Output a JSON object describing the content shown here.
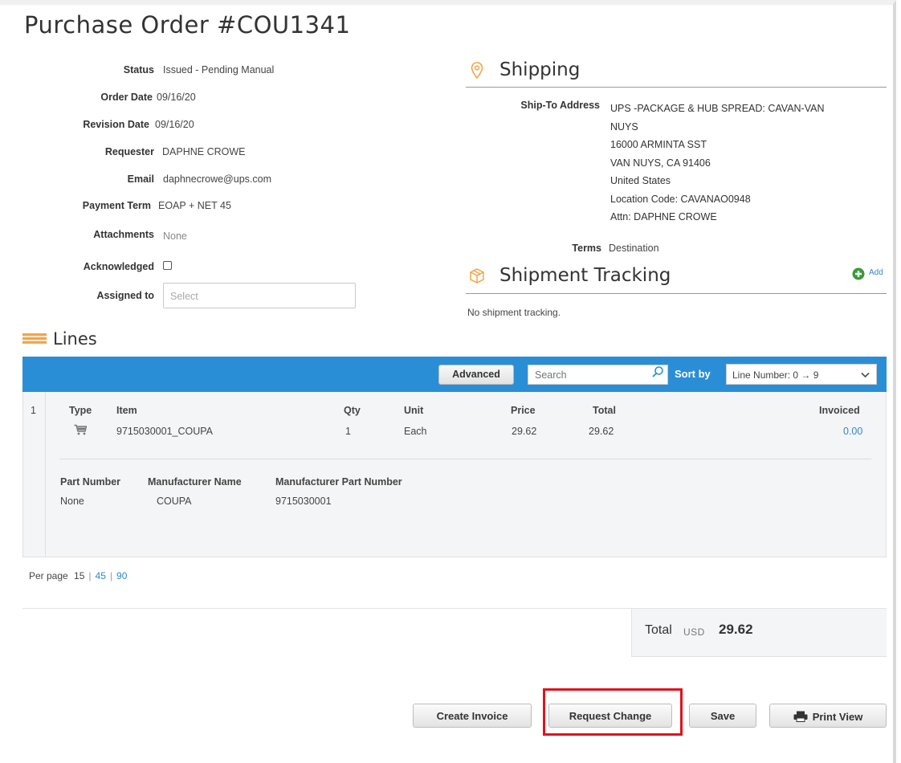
{
  "page": {
    "title": "Purchase Order #COU1341"
  },
  "details": {
    "status": {
      "label": "Status",
      "value": "Issued - Pending Manual"
    },
    "order_date": {
      "label": "Order Date",
      "value": "09/16/20"
    },
    "revision_date": {
      "label": "Revision Date",
      "value": "09/16/20"
    },
    "requester": {
      "label": "Requester",
      "value": "DAPHNE CROWE"
    },
    "email": {
      "label": "Email",
      "value": "daphnecrowe@ups.com"
    },
    "payment_term": {
      "label": "Payment Term",
      "value": "EOAP + NET 45"
    },
    "attachments": {
      "label": "Attachments",
      "value": "None"
    },
    "acknowledged": {
      "label": "Acknowledged",
      "checked": false
    },
    "assigned_to": {
      "label": "Assigned to",
      "placeholder": "Select"
    }
  },
  "shipping": {
    "heading": "Shipping",
    "icon": "location-pin-icon",
    "ship_to_label": "Ship-To Address",
    "address_lines": [
      "UPS -PACKAGE & HUB SPREAD: CAVAN-VAN",
      "NUYS",
      "16000 ARMINTA SST",
      "VAN NUYS, CA 91406",
      "United States",
      "Location Code: CAVANAO0948",
      "Attn: DAPHNE CROWE"
    ],
    "terms_label": "Terms",
    "terms_value": "Destination"
  },
  "tracking": {
    "heading": "Shipment Tracking",
    "icon": "package-box-icon",
    "add_label": "Add",
    "empty_text": "No shipment tracking."
  },
  "lines": {
    "heading": "Lines",
    "toolbar": {
      "advanced_label": "Advanced",
      "search_placeholder": "Search",
      "sort_by_label": "Sort by",
      "sort_value": "Line Number: 0 → 9"
    },
    "columns": {
      "type": "Type",
      "item": "Item",
      "qty": "Qty",
      "unit": "Unit",
      "price": "Price",
      "total": "Total",
      "invoiced": "Invoiced"
    },
    "rows": [
      {
        "number": "1",
        "item": "9715030001_COUPA",
        "qty": "1",
        "unit": "Each",
        "price": "29.62",
        "total": "29.62",
        "invoiced": "0.00",
        "detail_columns": {
          "part_number": "Part Number",
          "manufacturer_name": "Manufacturer Name",
          "manufacturer_part_number": "Manufacturer Part Number"
        },
        "part_number": "None",
        "manufacturer_name": "COUPA",
        "manufacturer_part_number": "9715030001"
      }
    ],
    "per_page": {
      "label": "Per page",
      "current": "15",
      "options": [
        "45",
        "90"
      ]
    }
  },
  "totals": {
    "label": "Total",
    "currency": "USD",
    "amount": "29.62"
  },
  "actions": {
    "create_invoice": "Create Invoice",
    "request_change": "Request Change",
    "save": "Save",
    "print_view": "Print View"
  },
  "colors": {
    "toolbar_blue": "#2a8ed6",
    "link_blue": "#2e8ad0",
    "highlight_red": "#e0121a",
    "section_icon_orange": "#f5a347",
    "add_icon_green": "#3a9a3a"
  }
}
